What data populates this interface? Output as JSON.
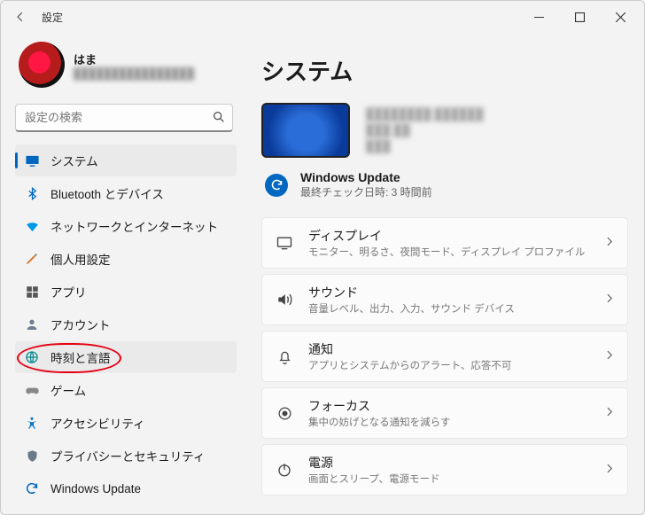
{
  "window": {
    "title": "設定"
  },
  "user": {
    "name": "はま",
    "email_masked": "████████████████"
  },
  "search": {
    "placeholder": "設定の検索"
  },
  "sidebar": {
    "items": [
      {
        "label": "システム"
      },
      {
        "label": "Bluetooth とデバイス"
      },
      {
        "label": "ネットワークとインターネット"
      },
      {
        "label": "個人用設定"
      },
      {
        "label": "アプリ"
      },
      {
        "label": "アカウント"
      },
      {
        "label": "時刻と言語"
      },
      {
        "label": "ゲーム"
      },
      {
        "label": "アクセシビリティ"
      },
      {
        "label": "プライバシーとセキュリティ"
      },
      {
        "label": "Windows Update"
      }
    ]
  },
  "main": {
    "page_title": "システム",
    "device": {
      "name_masked": "████████ ██████",
      "spec_masked": "███ ██",
      "extra_masked": "███"
    },
    "windows_update": {
      "title": "Windows Update",
      "subtitle": "最終チェック日時: 3 時間前"
    },
    "cards": [
      {
        "title": "ディスプレイ",
        "subtitle": "モニター、明るさ、夜間モード、ディスプレイ プロファイル"
      },
      {
        "title": "サウンド",
        "subtitle": "音量レベル、出力、入力、サウンド デバイス"
      },
      {
        "title": "通知",
        "subtitle": "アプリとシステムからのアラート、応答不可"
      },
      {
        "title": "フォーカス",
        "subtitle": "集中の妨げとなる通知を減らす"
      },
      {
        "title": "電源",
        "subtitle": "画面とスリープ、電源モード"
      }
    ]
  }
}
